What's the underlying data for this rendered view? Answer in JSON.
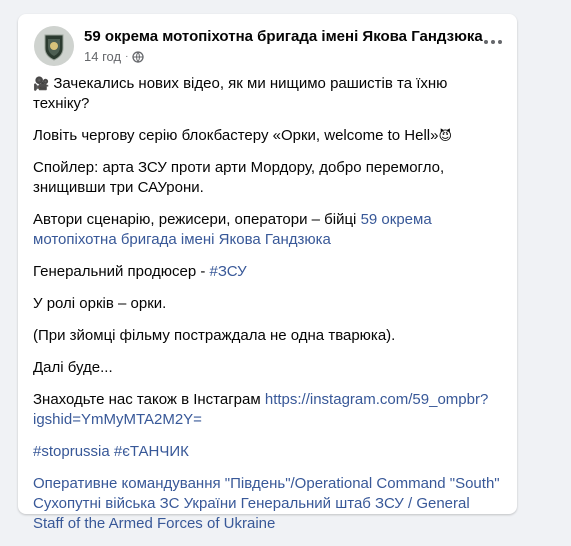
{
  "post": {
    "page_name": "59 окрема мотопіхотна бригада імені Якова Гандзюка",
    "time": "14 год",
    "lines": [
      {
        "emoji": "🎥",
        "text": " Зачекались нових відео, як ми нищимо рашистів та їхню техніку?"
      },
      {
        "text": "Ловіть чергову серію блокбастеру «Орки, welcome to Hell»",
        "emoji_after": "😈"
      },
      {
        "text": "  Спойлер: арта ЗСУ проти арти Мордору, добро перемогло, знищивши три САУрони."
      },
      {
        "text_before": "   Автори сценарію, режисери, оператори – бійці ",
        "link": "59 окрема мотопіхотна бригада імені Якова Гандзюка"
      },
      {
        "text_before": "Генеральний продюсер - ",
        "link": "#ЗСУ"
      },
      {
        "text": " У ролі орків – орки."
      },
      {
        "text": "(При зйомці фільму постраждала не одна тварюка)."
      },
      {
        "text": "Далі буде..."
      },
      {
        "text_before": "Знаходьте нас також в Інстаграм ",
        "link": "https://instagram.com/59_ompbr?igshid=YmMyMTA2M2Y="
      },
      {
        "link": " #stoprussia #єТАНЧИК"
      },
      {
        "link": "Оперативне командування \"Південь\"/Operational Command \"South\" Сухопутні війська ЗС України Генеральний штаб ЗСУ / General Staff of the Armed Forces of Ukraine"
      }
    ]
  },
  "icons": {
    "globe": "globe-icon",
    "more": "more-options-icon",
    "avatar": "brigade-emblem"
  },
  "colors": {
    "link": "#385898",
    "secondary_text": "#65676b",
    "background": "#f0f2f5"
  }
}
